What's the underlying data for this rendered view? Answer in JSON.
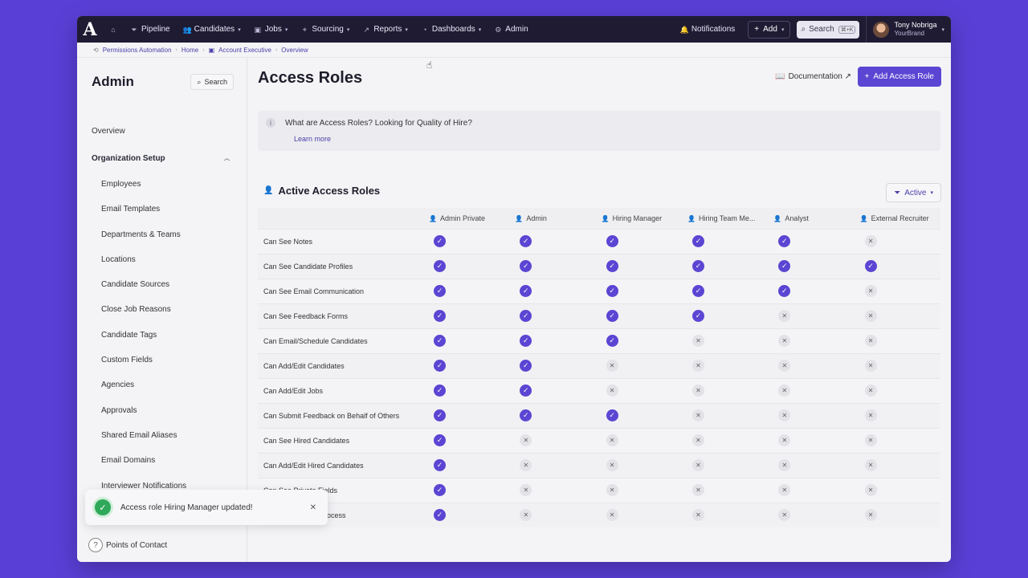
{
  "nav": {
    "logo": "A",
    "items": [
      {
        "label": "Pipeline",
        "icon": "filter-icon",
        "glyph": "⏷",
        "chevron": ""
      },
      {
        "label": "Candidates",
        "icon": "people-icon",
        "glyph": "👥",
        "chevron": "▾"
      },
      {
        "label": "Jobs",
        "icon": "briefcase-icon",
        "glyph": "▣",
        "chevron": "▾"
      },
      {
        "label": "Sourcing",
        "icon": "sourcing-icon",
        "glyph": "⌖",
        "chevron": "▾"
      },
      {
        "label": "Reports",
        "icon": "chart-icon",
        "glyph": "↗",
        "chevron": "▾"
      },
      {
        "label": "Dashboards",
        "icon": "dashboard-icon",
        "glyph": "◔",
        "chevron": "▾"
      },
      {
        "label": "Admin",
        "icon": "gear-icon",
        "glyph": "⚙",
        "chevron": ""
      }
    ],
    "notifications": "Notifications",
    "add": "Add",
    "search": "Search",
    "search_kbd": "⌘+K",
    "user_name": "Tony Nobriga",
    "user_org": "YourBrand"
  },
  "breadcrumb": [
    "Permissions Automation",
    "Home",
    "Account Executive",
    "Overview"
  ],
  "sidebar": {
    "title": "Admin",
    "search": "Search",
    "overview": "Overview",
    "group": "Organization Setup",
    "items": [
      "Employees",
      "Email Templates",
      "Departments & Teams",
      "Locations",
      "Candidate Sources",
      "Close Job Reasons",
      "Candidate Tags",
      "Custom Fields",
      "Agencies",
      "Approvals",
      "Shared Email Aliases",
      "Email Domains",
      "Interviewer Notifications"
    ],
    "footer": "Points of Contact"
  },
  "toast": {
    "message": "Access role Hiring Manager updated!"
  },
  "main": {
    "title": "Access Roles",
    "documentation": "Documentation ↗",
    "add_button": "Add Access Role",
    "info_text": "What are Access Roles? Looking for Quality of Hire?",
    "learn_more": "Learn more",
    "section_title": "Active Access Roles",
    "filter": "Active"
  },
  "table": {
    "columns": [
      "Admin Private",
      "Admin",
      "Hiring Manager",
      "Hiring Team Me...",
      "Analyst",
      "External Recruiter"
    ],
    "rows": [
      {
        "label": "Can See Notes",
        "values": [
          true,
          true,
          true,
          true,
          true,
          false
        ]
      },
      {
        "label": "Can See Candidate Profiles",
        "values": [
          true,
          true,
          true,
          true,
          true,
          true
        ]
      },
      {
        "label": "Can See Email Communication",
        "values": [
          true,
          true,
          true,
          true,
          true,
          false
        ]
      },
      {
        "label": "Can See Feedback Forms",
        "values": [
          true,
          true,
          true,
          true,
          false,
          false
        ]
      },
      {
        "label": "Can Email/Schedule Candidates",
        "values": [
          true,
          true,
          true,
          false,
          false,
          false
        ]
      },
      {
        "label": "Can Add/Edit Candidates",
        "values": [
          true,
          true,
          false,
          false,
          false,
          false
        ]
      },
      {
        "label": "Can Add/Edit Jobs",
        "values": [
          true,
          true,
          false,
          false,
          false,
          false
        ]
      },
      {
        "label": "Can Submit Feedback on Behalf of Others",
        "values": [
          true,
          true,
          true,
          false,
          false,
          false
        ]
      },
      {
        "label": "Can See Hired Candidates",
        "values": [
          true,
          false,
          false,
          false,
          false,
          false
        ]
      },
      {
        "label": "Can Add/Edit Hired Candidates",
        "values": [
          true,
          false,
          false,
          false,
          false,
          false
        ]
      },
      {
        "label": "Can See Private Fields",
        "values": [
          true,
          false,
          false,
          false,
          false,
          false
        ]
      },
      {
        "label": "Edits to Approval Process",
        "values": [
          true,
          false,
          false,
          false,
          false,
          false
        ]
      }
    ]
  },
  "colors": {
    "accent": "#5b45d3",
    "nav_bg": "#1f1b33",
    "backdrop": "#5a3fd6",
    "success": "#2fa85a"
  }
}
